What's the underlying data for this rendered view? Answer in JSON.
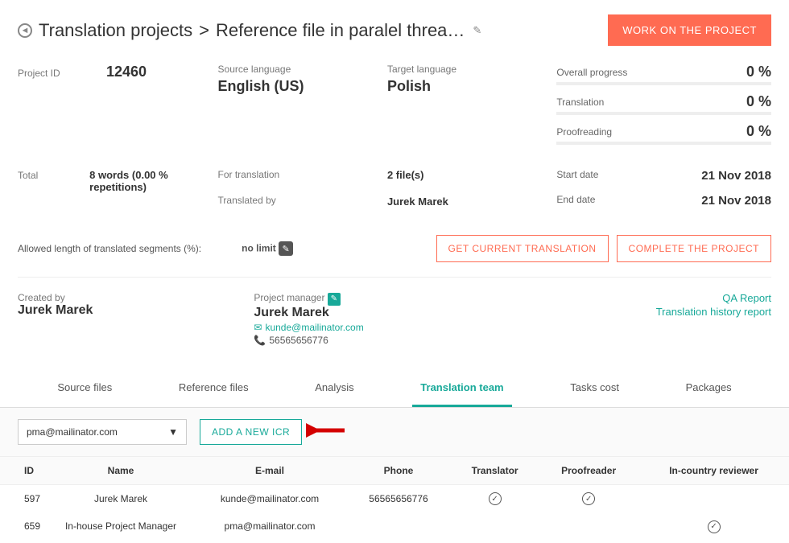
{
  "breadcrumb": {
    "parent": "Translation projects",
    "current": "Reference file in paralel threa…"
  },
  "primary_action": "WORK ON THE PROJECT",
  "project": {
    "id_label": "Project ID",
    "id": "12460",
    "total_label": "Total",
    "total_value": "8 words (0.00 % repetitions)",
    "source_lang_label": "Source language",
    "source_lang": "English (US)",
    "target_lang_label": "Target language",
    "target_lang": "Polish",
    "for_translation_label": "For translation",
    "for_translation_value": "2 file(s)",
    "translated_by_label": "Translated by",
    "translated_by_value": "Jurek Marek"
  },
  "progress": {
    "overall_label": "Overall progress",
    "overall_value": "0 %",
    "translation_label": "Translation",
    "translation_value": "0 %",
    "proofreading_label": "Proofreading",
    "proofreading_value": "0 %",
    "start_label": "Start date",
    "start_value": "21 Nov 2018",
    "end_label": "End date",
    "end_value": "21 Nov 2018"
  },
  "limit": {
    "label": "Allowed length of translated segments (%):",
    "value": "no limit"
  },
  "actions": {
    "get_translation": "GET CURRENT TRANSLATION",
    "complete": "COMPLETE THE PROJECT"
  },
  "meta": {
    "created_by_label": "Created by",
    "created_by": "Jurek Marek",
    "pm_label": "Project manager",
    "pm_name": "Jurek Marek",
    "pm_email": "kunde@mailinator.com",
    "pm_phone": "56565656776",
    "qa_report": "QA Report",
    "history_report": "Translation history report"
  },
  "tabs": {
    "source": "Source files",
    "reference": "Reference files",
    "analysis": "Analysis",
    "team": "Translation team",
    "tasks": "Tasks cost",
    "packages": "Packages"
  },
  "team_controls": {
    "select_value": "pma@mailinator.com",
    "add_button": "ADD A NEW ICR"
  },
  "team_table": {
    "headers": {
      "id": "ID",
      "name": "Name",
      "email": "E-mail",
      "phone": "Phone",
      "translator": "Translator",
      "proofreader": "Proofreader",
      "icr": "In-country reviewer"
    },
    "rows": [
      {
        "id": "597",
        "name": "Jurek Marek",
        "email": "kunde@mailinator.com",
        "phone": "56565656776",
        "translator": true,
        "proofreader": true,
        "icr": false
      },
      {
        "id": "659",
        "name": "In-house Project Manager",
        "email": "pma@mailinator.com",
        "phone": "",
        "translator": false,
        "proofreader": false,
        "icr": true
      }
    ]
  }
}
